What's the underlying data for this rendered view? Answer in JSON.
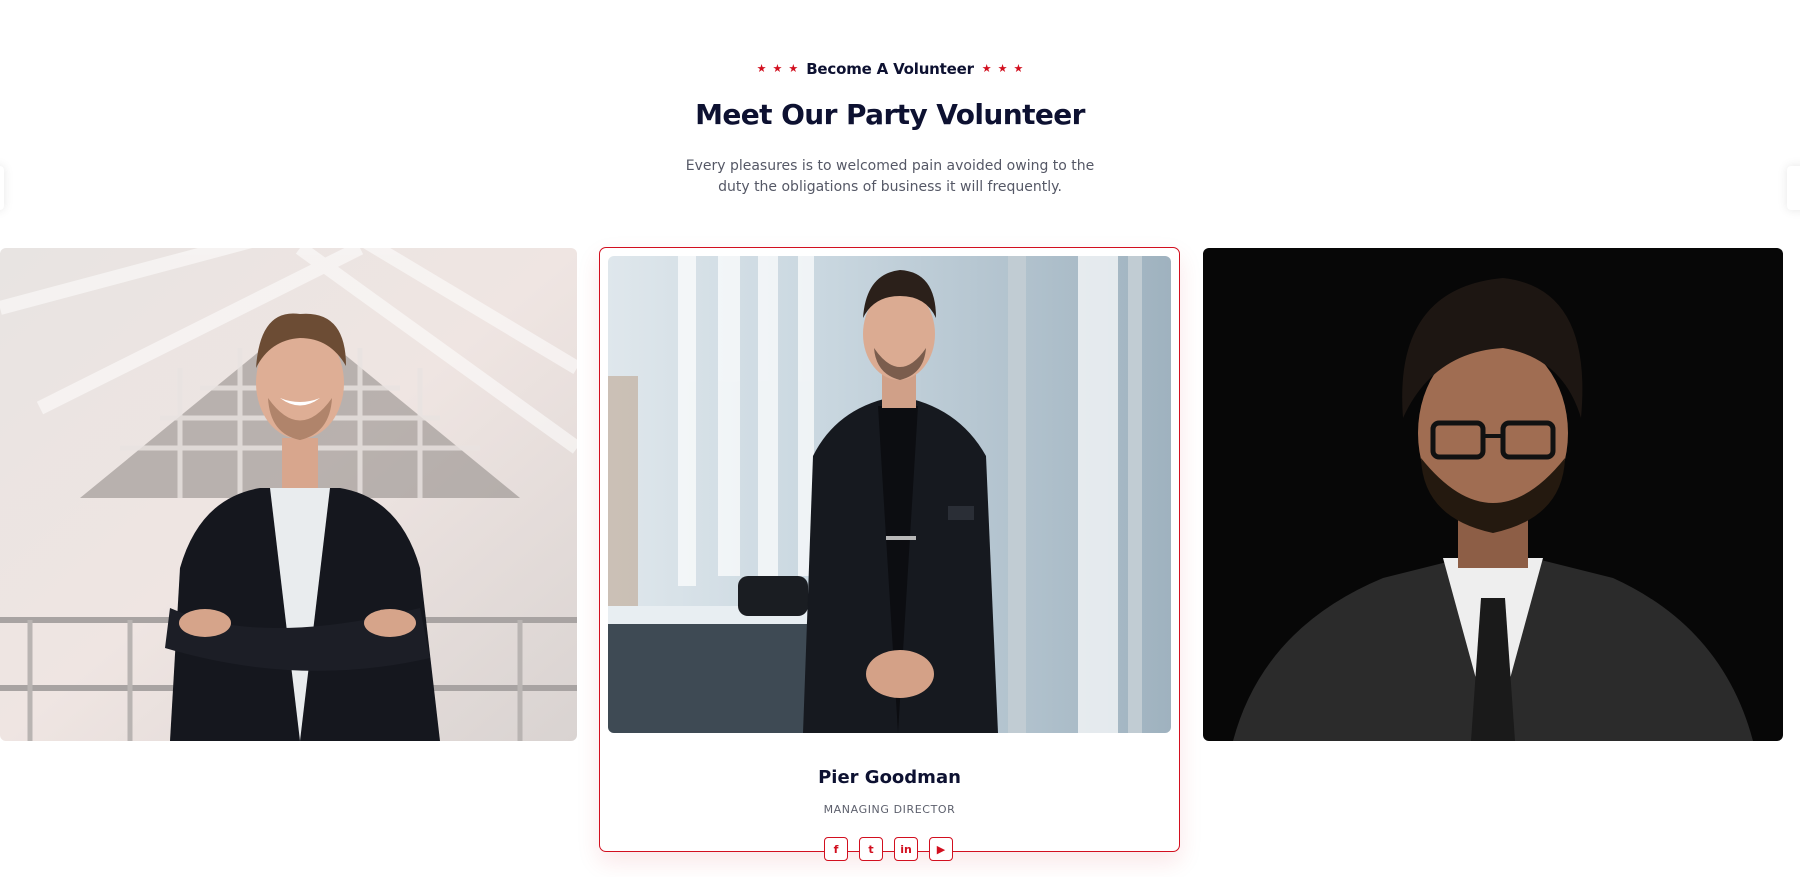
{
  "section": {
    "subtitle": "Become A Volunteer",
    "title": "Meet Our Party Volunteer",
    "description": "Every pleasures is to welcomed pain avoided owing to the duty the obligations of business it will frequently."
  },
  "theme": {
    "accent": "#d20f1f",
    "heading": "#0d1131",
    "body_text": "#555866"
  },
  "volunteers": [
    {
      "photo": "smiling-man-arms-crossed-photo"
    },
    {
      "name": "Pier Goodman",
      "role": "MANAGING DIRECTOR",
      "photo": "man-in-dark-suit-office-photo",
      "social": [
        {
          "icon": "facebook-icon",
          "glyph": "f"
        },
        {
          "icon": "twitter-icon",
          "glyph": "t"
        },
        {
          "icon": "linkedin-icon",
          "glyph": "in"
        },
        {
          "icon": "youtube-icon",
          "glyph": "▶"
        }
      ]
    },
    {
      "photo": "man-with-glasses-dark-background-photo"
    }
  ]
}
